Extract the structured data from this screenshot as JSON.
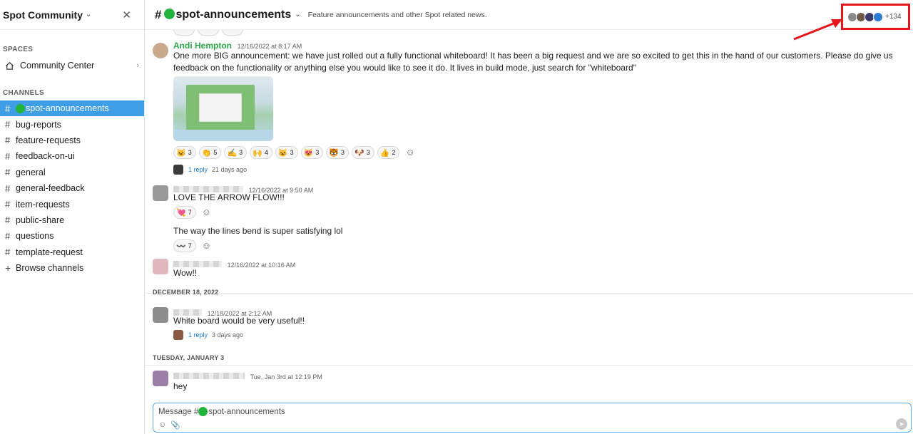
{
  "workspace": {
    "name": "Spot Community"
  },
  "sidebar": {
    "spaces_title": "SPACES",
    "spaces": [
      {
        "label": "Community Center"
      }
    ],
    "channels_title": "CHANNELS",
    "channels": [
      {
        "label": "spot-announcements",
        "active": true
      },
      {
        "label": "bug-reports"
      },
      {
        "label": "feature-requests"
      },
      {
        "label": "feedback-on-ui"
      },
      {
        "label": "general"
      },
      {
        "label": "general-feedback"
      },
      {
        "label": "item-requests"
      },
      {
        "label": "public-share"
      },
      {
        "label": "questions"
      },
      {
        "label": "template-request"
      }
    ],
    "browse_label": "Browse channels"
  },
  "header": {
    "hash": "#",
    "channel": "spot-announcements",
    "description": "Feature announcements and other Spot related news.",
    "member_count": "+134"
  },
  "messages": [
    {
      "author": "Andi Hempton",
      "time": "12/16/2022 at 8:17 AM",
      "text": "One more BIG announcement: we have just rolled out a fully functional whiteboard! It has been a big request and we are so excited to get this in the hand of our customers. Please do give us feedback on the functionality or anything else you would like to see it do. It lives in build mode, just search for \"whiteboard\"",
      "reactions": [
        {
          "emoji": "🐱",
          "count": "3"
        },
        {
          "emoji": "👏",
          "count": "5"
        },
        {
          "emoji": "✍️",
          "count": "3"
        },
        {
          "emoji": "🙌",
          "count": "4"
        },
        {
          "emoji": "😺",
          "count": "3"
        },
        {
          "emoji": "😻",
          "count": "3"
        },
        {
          "emoji": "🐯",
          "count": "3"
        },
        {
          "emoji": "🐶",
          "count": "3"
        },
        {
          "emoji": "👍",
          "count": "2"
        }
      ],
      "reply": {
        "link": "1 reply",
        "time": "21 days ago"
      }
    },
    {
      "time": "12/16/2022 at 9:50 AM",
      "text": "LOVE THE ARROW FLOW!!!",
      "reactions": [
        {
          "emoji": "💘",
          "count": "7"
        }
      ],
      "text2": "The way the lines bend is super satisfying lol",
      "reactions2": [
        {
          "emoji": "〰️",
          "count": "7"
        }
      ]
    },
    {
      "time": "12/16/2022 at 10:16 AM",
      "text": "Wow!!"
    },
    {
      "time": "12/18/2022 at 2:12 AM",
      "text": "White board would be very useful!!",
      "reply": {
        "link": "1 reply",
        "time": "3 days ago"
      }
    },
    {
      "time": "Tue, Jan 3rd at 12:19 PM",
      "text": "hey"
    }
  ],
  "dividers": [
    "DECEMBER 18, 2022",
    "TUESDAY, JANUARY 3"
  ],
  "composer": {
    "prefix": "Message #",
    "channel": "spot-announcements"
  },
  "colors": {
    "active_channel": "#3e9fe6",
    "status_dot": "#22b33d",
    "author": "#2aa54a",
    "link": "#1d7ed1",
    "highlight": "#e8141b"
  }
}
